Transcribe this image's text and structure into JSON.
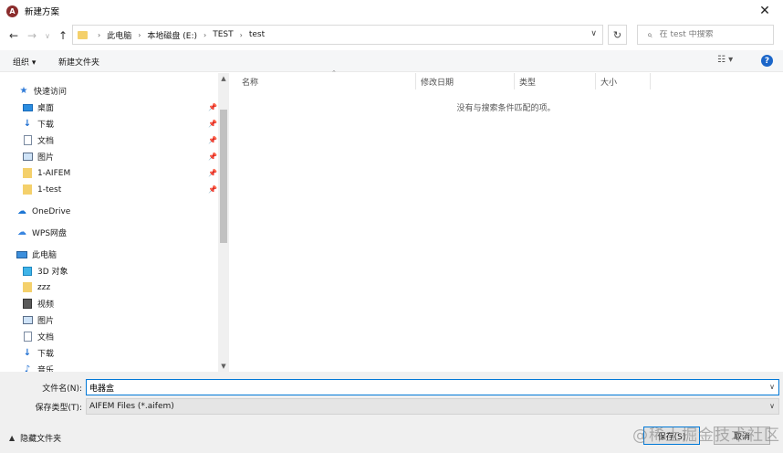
{
  "window": {
    "title": "新建方案",
    "app_icon": "aifem-logo-icon",
    "close": "✕"
  },
  "nav": {
    "back_icon": "←",
    "forward_icon": "→",
    "dropdown_icon": "∨",
    "up_icon": "↑",
    "breadcrumbs": [
      "此电脑",
      "本地磁盘 (E:)",
      "TEST",
      "test"
    ],
    "search_placeholder": "在 test 中搜索"
  },
  "toolbar": {
    "organize": "组织 ▾",
    "new_folder": "新建文件夹"
  },
  "sidebar": {
    "quick_access": "快速访问",
    "quick_items": [
      {
        "label": "桌面",
        "icon": "desktop-icon"
      },
      {
        "label": "下载",
        "icon": "download-icon"
      },
      {
        "label": "文档",
        "icon": "document-icon"
      },
      {
        "label": "图片",
        "icon": "pictures-icon"
      },
      {
        "label": "1-AIFEM",
        "icon": "folder-icon"
      },
      {
        "label": "1-test",
        "icon": "folder-icon"
      }
    ],
    "onedrive": "OneDrive",
    "wps": "WPS网盘",
    "this_pc": "此电脑",
    "pc_items": [
      {
        "label": "3D 对象",
        "icon": "3d-objects-icon"
      },
      {
        "label": "zzz",
        "icon": "folder-icon"
      },
      {
        "label": "视频",
        "icon": "video-icon"
      },
      {
        "label": "图片",
        "icon": "pictures-icon"
      },
      {
        "label": "文档",
        "icon": "document-icon"
      },
      {
        "label": "下载",
        "icon": "download-icon"
      },
      {
        "label": "音乐",
        "icon": "music-icon"
      }
    ]
  },
  "filelist": {
    "columns": [
      "名称",
      "修改日期",
      "类型",
      "大小"
    ],
    "empty_message": "没有与搜索条件匹配的项。"
  },
  "bottom": {
    "filename_label": "文件名(N):",
    "filename_value": "电器盒",
    "filetype_label": "保存类型(T):",
    "filetype_value": "AIFEM Files (*.aifem)",
    "hide_folders": "隐藏文件夹",
    "save": "保存(S)",
    "cancel": "取消"
  },
  "watermark": "@稀土掘金技术社区",
  "colors": {
    "accent": "#0078d7",
    "help": "#1b66c9",
    "folder": "#f4d06b"
  }
}
